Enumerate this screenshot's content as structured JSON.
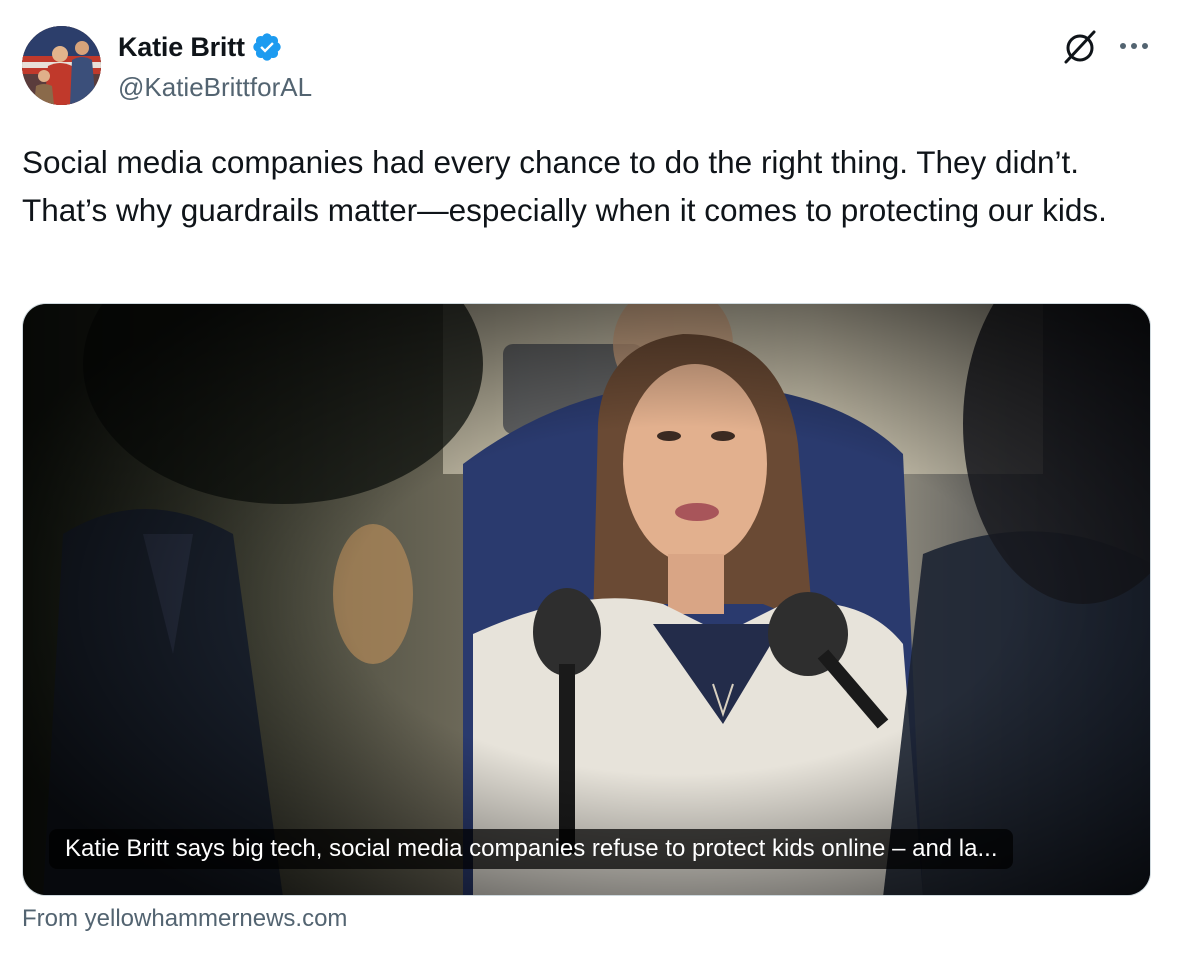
{
  "author": {
    "name": "Katie Britt",
    "handle": "@KatieBrittforAL",
    "verified": true,
    "avatar_icon": "avatar-photo"
  },
  "actions": {
    "grok_icon": "grok-icon",
    "more_icon": "more-icon"
  },
  "tweet": {
    "text": "Social media companies had every chance to do the right thing. They didn’t. That’s why guardrails matter—especially when it comes to protecting our kids."
  },
  "link_card": {
    "caption": "Katie Britt says big tech, social media companies refuse to protect kids online – and la...",
    "source": "From yellowhammernews.com"
  },
  "colors": {
    "text": "#0f1419",
    "secondary": "#536471",
    "verified_blue": "#1d9bf0",
    "border": "#cfd9de"
  }
}
